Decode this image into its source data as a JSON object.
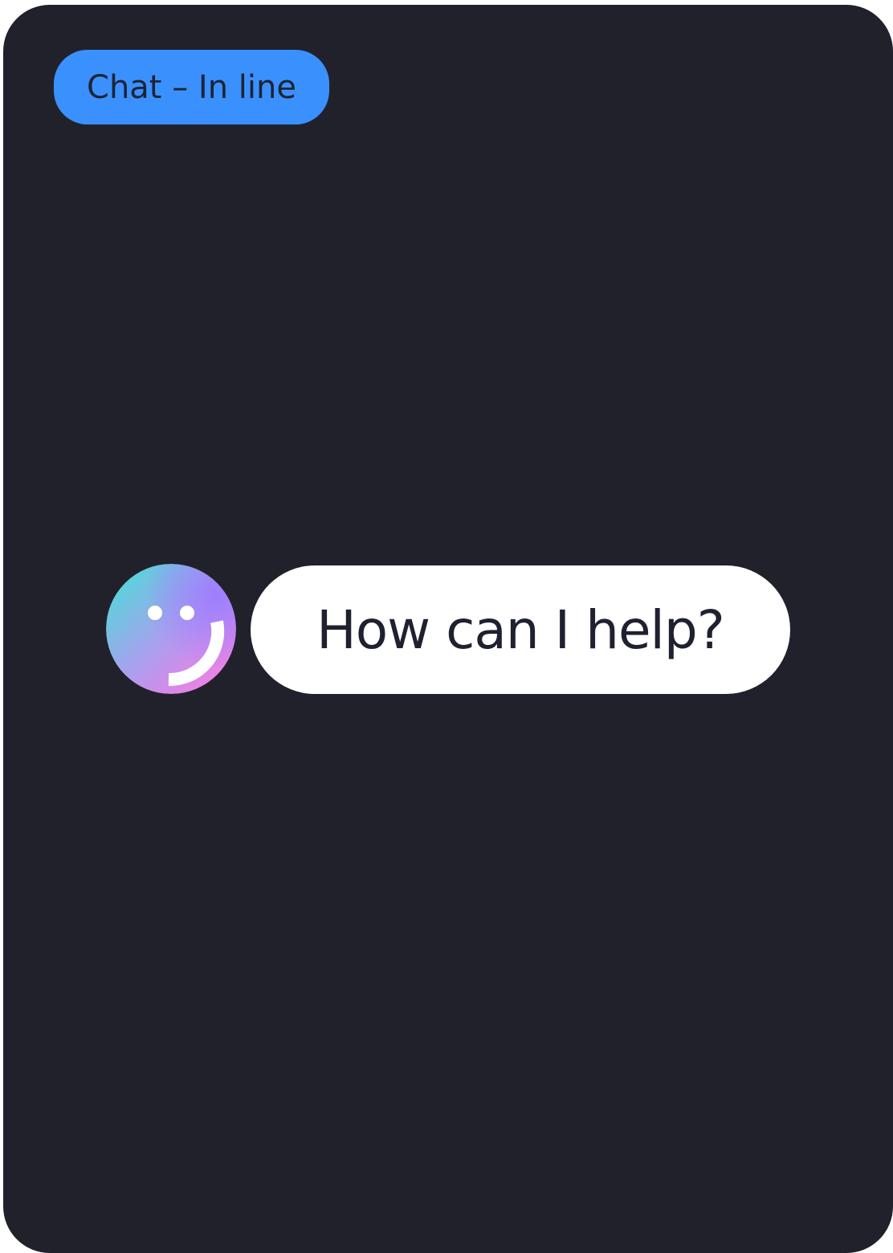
{
  "tag": {
    "label": "Chat – In line",
    "color": "#3a91fd"
  },
  "assistant": {
    "avatar_icon": "smiley-face-icon",
    "avatar_gradient": [
      "#3fe3d6",
      "#a07cff",
      "#ff7fe0"
    ],
    "message": "How can I help?"
  },
  "colors": {
    "background": "#21212b",
    "bubble": "#ffffff",
    "text_dark": "#1f2130"
  }
}
